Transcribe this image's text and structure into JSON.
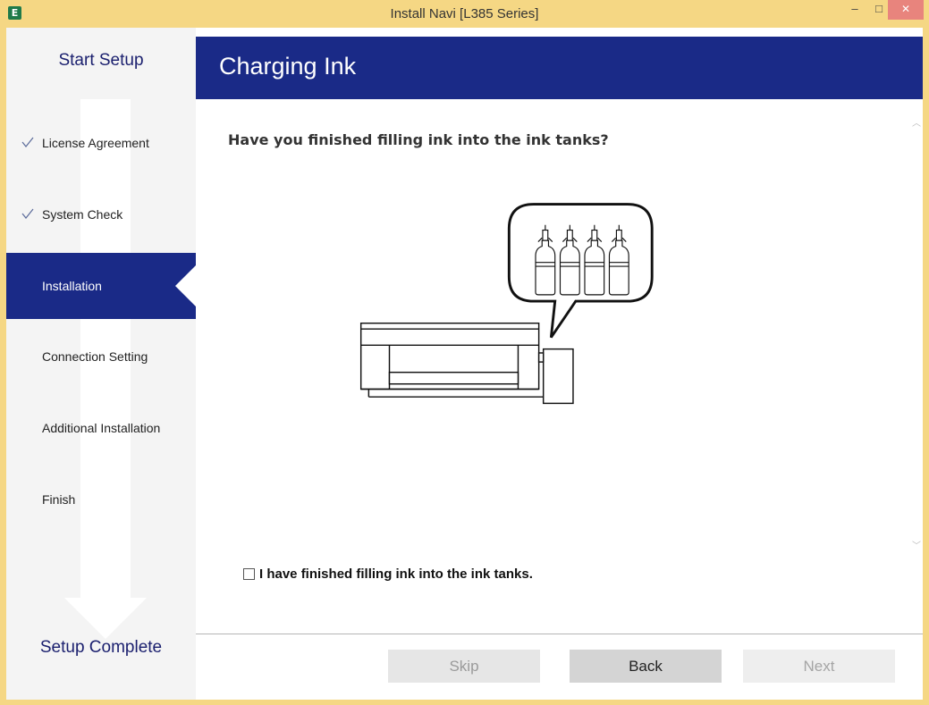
{
  "window": {
    "title": "Install Navi [L385 Series]",
    "app_icon_letter": "E",
    "minimize_glyph": "–",
    "maximize_glyph": "□",
    "close_glyph": "✕"
  },
  "sidebar": {
    "start_label": "Start Setup",
    "end_label": "Setup Complete",
    "steps": [
      {
        "label": "License Agreement",
        "status": "completed"
      },
      {
        "label": "System Check",
        "status": "completed"
      },
      {
        "label": "Installation",
        "status": "current"
      },
      {
        "label": "Connection Setting",
        "status": "pending"
      },
      {
        "label": "Additional Installation",
        "status": "pending"
      },
      {
        "label": "Finish",
        "status": "pending"
      }
    ]
  },
  "header": {
    "title": "Charging Ink"
  },
  "main": {
    "question": "Have you finished filling ink into the ink tanks?",
    "checkbox_label": "I have finished filling ink into the ink tanks.",
    "checkbox_checked": false
  },
  "footer": {
    "skip_label": "Skip",
    "back_label": "Back",
    "next_label": "Next"
  },
  "colors": {
    "accent": "#1a2a87",
    "title_bar": "#f5d784",
    "close_button": "#e8847d"
  }
}
